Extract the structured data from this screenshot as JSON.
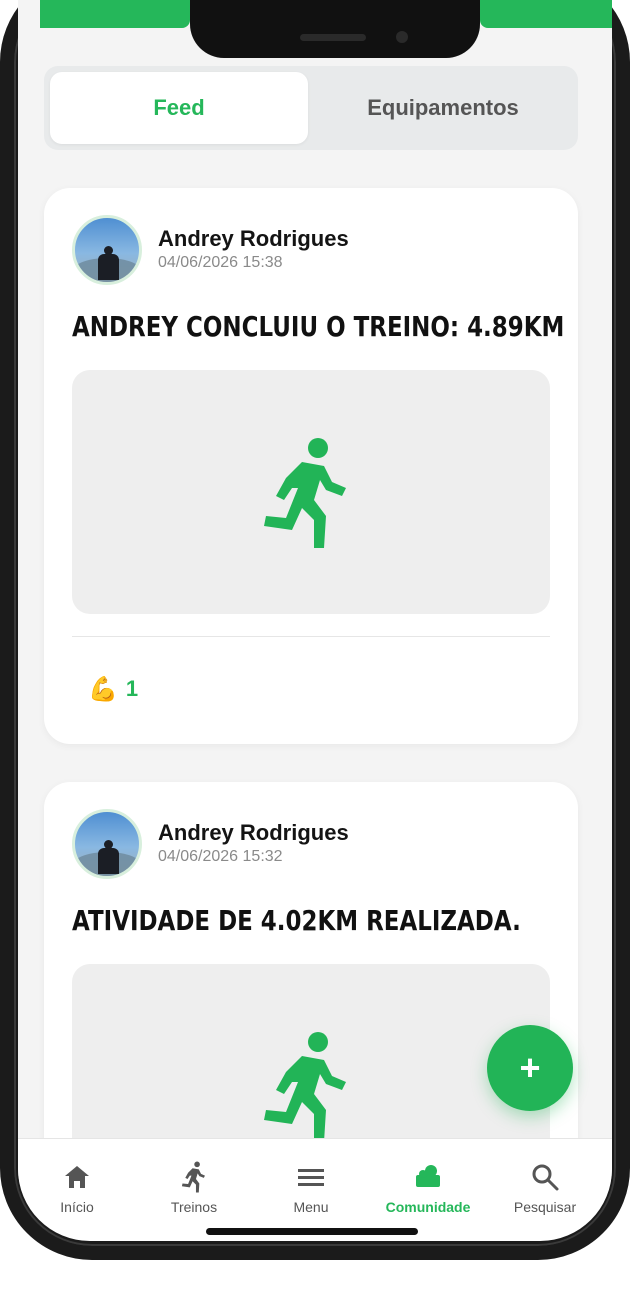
{
  "colors": {
    "accent": "#25b75a",
    "frame": "#1b1b1b",
    "background": "#f4f4f4"
  },
  "tabs": [
    {
      "label": "Feed",
      "active": true
    },
    {
      "label": "Equipamentos",
      "active": false
    }
  ],
  "posts": [
    {
      "author": "Andrey Rodrigues",
      "timestamp": "04/06/2026 15:38",
      "title": "ANDREY CONCLUIU O TREINO: 4.89KM",
      "media_icon": "running-person-icon",
      "reaction_icon": "flexed-biceps-icon",
      "reaction_emoji": "💪",
      "reaction_count": "1"
    },
    {
      "author": "Andrey Rodrigues",
      "timestamp": "04/06/2026 15:32",
      "title": "ATIVIDADE DE 4.02KM REALIZADA.",
      "media_icon": "running-person-icon"
    }
  ],
  "fab": {
    "label": "+",
    "icon": "plus-icon"
  },
  "nav": [
    {
      "label": "Início",
      "icon": "home-icon",
      "active": false
    },
    {
      "label": "Treinos",
      "icon": "running-person-icon",
      "active": false
    },
    {
      "label": "Menu",
      "icon": "menu-icon",
      "active": false
    },
    {
      "label": "Comunidade",
      "icon": "community-icon",
      "active": true
    },
    {
      "label": "Pesquisar",
      "icon": "search-icon",
      "active": false
    }
  ]
}
